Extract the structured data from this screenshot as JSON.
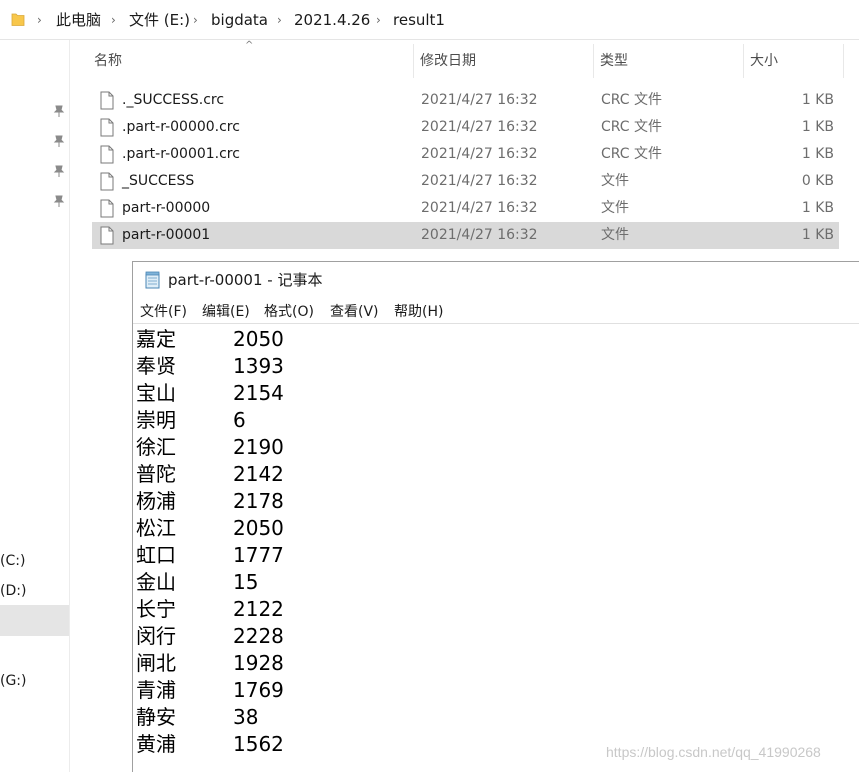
{
  "breadcrumb": {
    "items": [
      "此电脑",
      "文件 (E:)",
      "bigdata",
      "2021.4.26",
      "result1"
    ]
  },
  "columns": {
    "name": "名称",
    "date": "修改日期",
    "type": "类型",
    "size": "大小"
  },
  "files": [
    {
      "name": "._SUCCESS.crc",
      "date": "2021/4/27 16:32",
      "type": "CRC 文件",
      "size": "1 KB",
      "selected": false
    },
    {
      "name": ".part-r-00000.crc",
      "date": "2021/4/27 16:32",
      "type": "CRC 文件",
      "size": "1 KB",
      "selected": false
    },
    {
      "name": ".part-r-00001.crc",
      "date": "2021/4/27 16:32",
      "type": "CRC 文件",
      "size": "1 KB",
      "selected": false
    },
    {
      "name": "_SUCCESS",
      "date": "2021/4/27 16:32",
      "type": "文件",
      "size": "0 KB",
      "selected": false
    },
    {
      "name": "part-r-00000",
      "date": "2021/4/27 16:32",
      "type": "文件",
      "size": "1 KB",
      "selected": false
    },
    {
      "name": "part-r-00001",
      "date": "2021/4/27 16:32",
      "type": "文件",
      "size": "1 KB",
      "selected": true
    }
  ],
  "nav": {
    "drives": [
      "(C:)",
      "(D:)",
      "(G:)"
    ]
  },
  "notepad": {
    "title": "part-r-00001 - 记事本",
    "menu": [
      "文件(F)",
      "编辑(E)",
      "格式(O)",
      "查看(V)",
      "帮助(H)"
    ],
    "lines": [
      {
        "key": "嘉定",
        "value": "2050"
      },
      {
        "key": "奉贤",
        "value": "1393"
      },
      {
        "key": "宝山",
        "value": "2154"
      },
      {
        "key": "崇明",
        "value": "6"
      },
      {
        "key": "徐汇",
        "value": "2190"
      },
      {
        "key": "普陀",
        "value": "2142"
      },
      {
        "key": "杨浦",
        "value": "2178"
      },
      {
        "key": "松江",
        "value": "2050"
      },
      {
        "key": "虹口",
        "value": "1777"
      },
      {
        "key": "金山",
        "value": "15"
      },
      {
        "key": "长宁",
        "value": "2122"
      },
      {
        "key": "闵行",
        "value": "2228"
      },
      {
        "key": "闸北",
        "value": "1928"
      },
      {
        "key": "青浦",
        "value": "1769"
      },
      {
        "key": "静安",
        "value": "38"
      },
      {
        "key": "黄浦",
        "value": "1562"
      }
    ]
  },
  "watermark": "https://blog.csdn.net/qq_41990268",
  "colors": {
    "selected_row": "#d9d9d9",
    "folder": "#f8c74b"
  }
}
